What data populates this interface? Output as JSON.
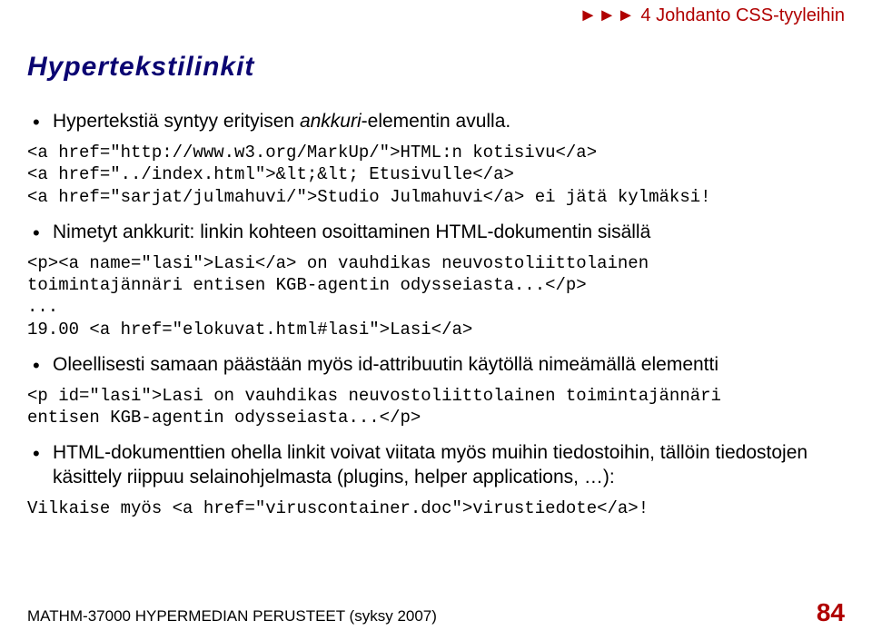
{
  "top": {
    "arrows": "►►►",
    "chapter": "4 Johdanto CSS-tyyleihin"
  },
  "heading": "Hypertekstilinkit",
  "bullets": {
    "b1": "Hypertekstiä syntyy erityisen ankkuri-elementin avulla.",
    "b2": "Nimetyt ankkurit: linkin kohteen osoittaminen HTML-dokumentin sisällä",
    "b3": "Oleellisesti samaan päästään myös id-attribuutin käytöllä nimeämällä elementti",
    "b4a": "HTML-dokumenttien ohella linkit voivat viitata myös muihin tiedostoihin, tällöin tiedostojen käsittely riippuu selainohjelmasta (plugins, helper applications, …):"
  },
  "code": {
    "c1": "<a href=\"http://www.w3.org/MarkUp/\">HTML:n kotisivu</a>\n<a href=\"../index.html\">&lt;&lt; Etusivulle</a>\n<a href=\"sarjat/julmahuvi/\">Studio Julmahuvi</a> ei jätä kylmäksi!",
    "c2": "<p><a name=\"lasi\">Lasi</a> on vauhdikas neuvostoliittolainen\ntoimintajännäri entisen KGB-agentin odysseiasta...</p>\n...\n19.00 <a href=\"elokuvat.html#lasi\">Lasi</a>",
    "c3": "<p id=\"lasi\">Lasi on vauhdikas neuvostoliittolainen toimintajännäri\nentisen KGB-agentin odysseiasta...</p>",
    "c4": "Vilkaise myös <a href=\"viruscontainer.doc\">virustiedote</a>!"
  },
  "footer": {
    "left": "MATHM-37000 HYPERMEDIAN PERUSTEET (syksy 2007)",
    "right": "84"
  }
}
